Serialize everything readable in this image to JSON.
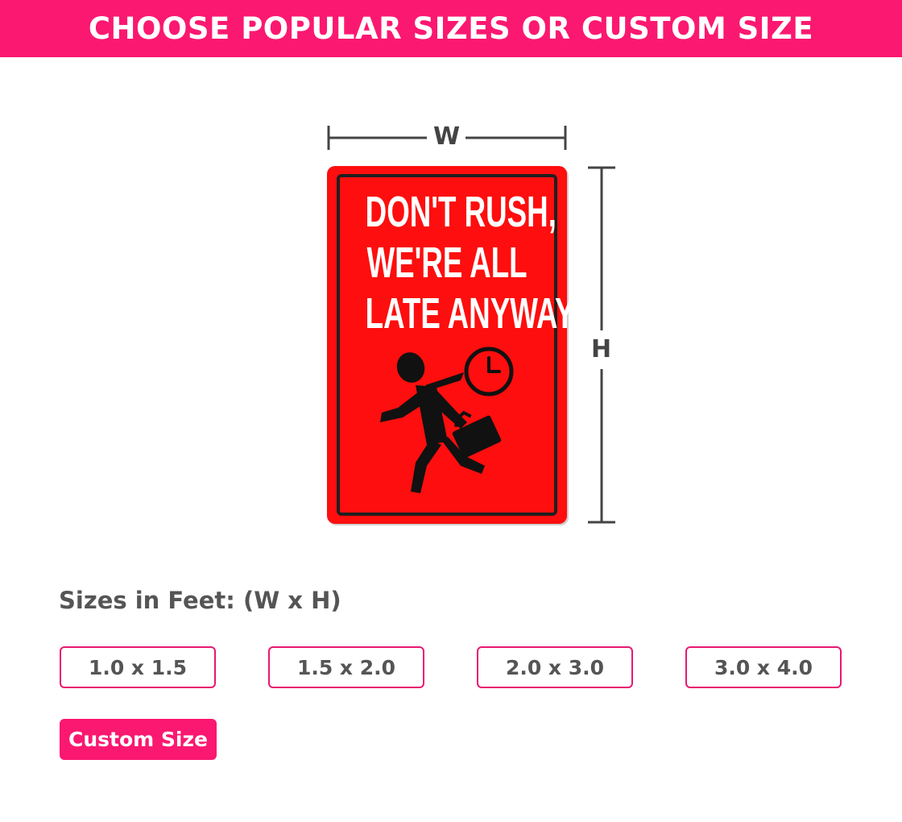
{
  "header": {
    "title": "CHOOSE POPULAR SIZES OR CUSTOM SIZE"
  },
  "diagram": {
    "width_label": "W",
    "height_label": "H",
    "sign": {
      "lines": [
        "DON'T RUSH,",
        "WE'RE ALL",
        "LATE ANYWAY"
      ],
      "background_color": "#fe0e0e",
      "text_color": "#ffffff",
      "icon": "running-businessman-clock-icon"
    }
  },
  "sizes": {
    "label": "Sizes in Feet: (W x H)",
    "options": [
      "1.0 x 1.5",
      "1.5 x 2.0",
      "2.0 x 3.0",
      "3.0 x 4.0"
    ],
    "custom_label": "Custom Size"
  },
  "colors": {
    "accent": "#fb1870",
    "text_gray": "#555555",
    "dimension_gray": "#444444"
  }
}
